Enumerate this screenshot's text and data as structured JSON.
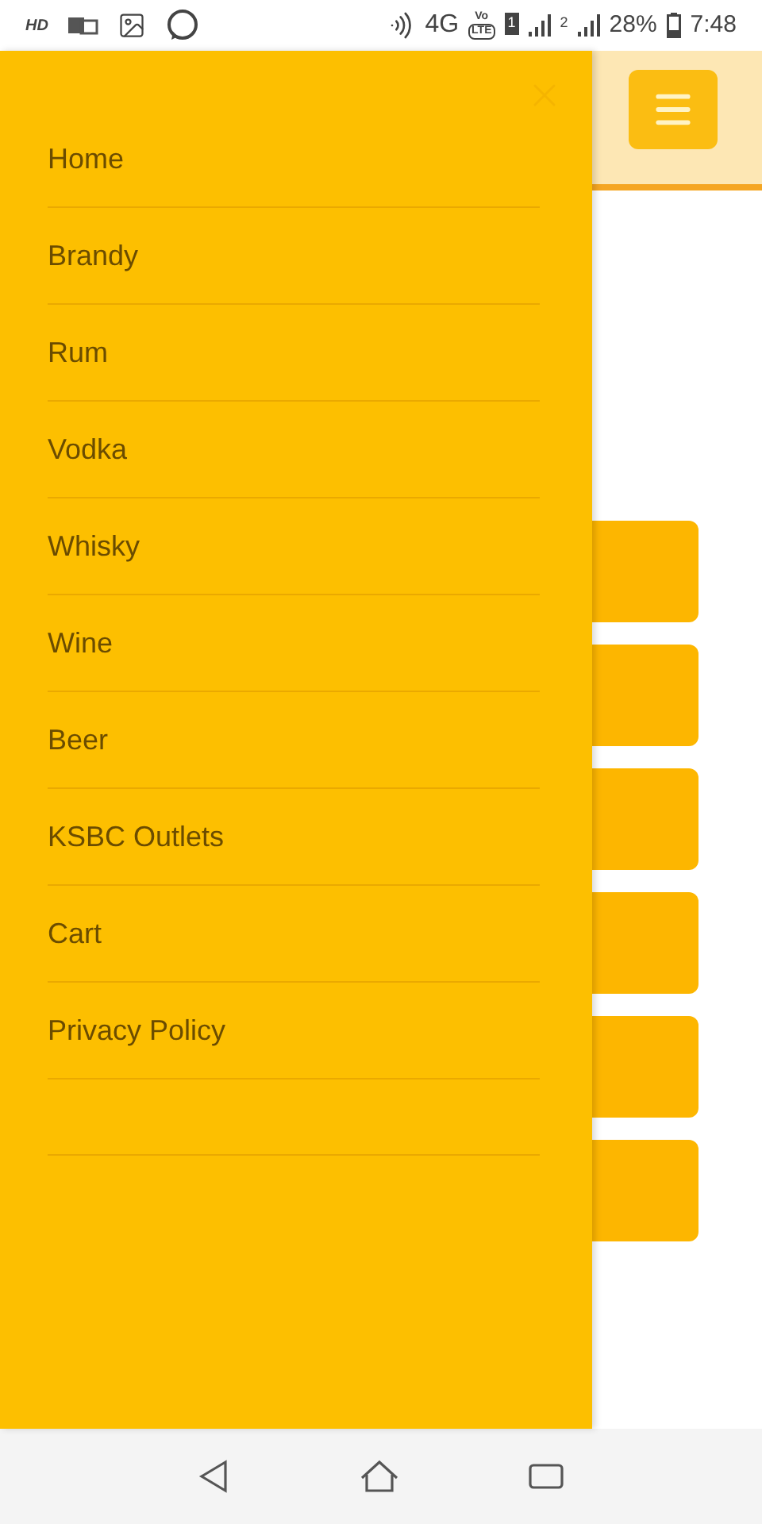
{
  "status_bar": {
    "hd": "HD",
    "network": "4G",
    "volte": [
      "Vo",
      "LTE"
    ],
    "sim_1": "1",
    "sim_2": "2",
    "battery": "28%",
    "time": "7:48"
  },
  "menu": {
    "items": [
      {
        "label": "Home"
      },
      {
        "label": "Brandy"
      },
      {
        "label": "Rum"
      },
      {
        "label": "Vodka"
      },
      {
        "label": "Whisky"
      },
      {
        "label": "Wine"
      },
      {
        "label": "Beer"
      },
      {
        "label": "KSBC Outlets"
      },
      {
        "label": "Cart"
      },
      {
        "label": "Privacy Policy"
      }
    ]
  },
  "cards": [
    {
      "kind": "card"
    },
    {
      "kind": "card"
    },
    {
      "kind": "card"
    },
    {
      "kind": "card"
    },
    {
      "kind": "card"
    },
    {
      "kind": "card"
    }
  ]
}
